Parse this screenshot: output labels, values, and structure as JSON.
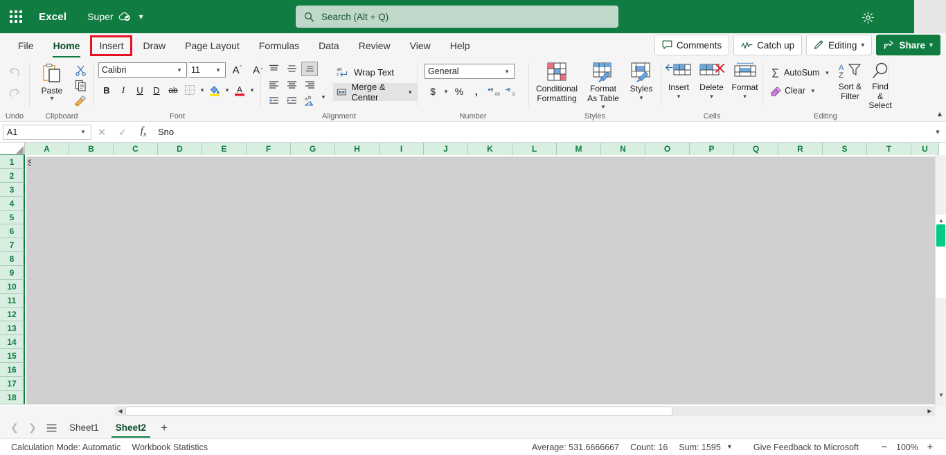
{
  "titlebar": {
    "app_name": "Excel",
    "doc_name": "Super",
    "waffle_icon": "app-launcher-icon",
    "cloud_icon": "cloud-saved-icon",
    "chevron_icon": "chevron-down-icon",
    "gear_icon": "gear-icon",
    "brand_color": "#107C41"
  },
  "search": {
    "placeholder": "Search (Alt + Q)",
    "value": "",
    "icon": "search-icon"
  },
  "ribbon_tabs": [
    {
      "label": "File",
      "active": false,
      "highlighted": false
    },
    {
      "label": "Home",
      "active": true,
      "highlighted": false
    },
    {
      "label": "Insert",
      "active": false,
      "highlighted": true
    },
    {
      "label": "Draw",
      "active": false,
      "highlighted": false
    },
    {
      "label": "Page Layout",
      "active": false,
      "highlighted": false
    },
    {
      "label": "Formulas",
      "active": false,
      "highlighted": false
    },
    {
      "label": "Data",
      "active": false,
      "highlighted": false
    },
    {
      "label": "Review",
      "active": false,
      "highlighted": false
    },
    {
      "label": "View",
      "active": false,
      "highlighted": false
    },
    {
      "label": "Help",
      "active": false,
      "highlighted": false
    }
  ],
  "highlight_color": "#E81123",
  "tab_actions": {
    "comments": "Comments",
    "catch_up": "Catch up",
    "editing": "Editing",
    "share": "Share"
  },
  "ribbon": {
    "undo": {
      "label": "Undo",
      "undo_icon": "undo-icon",
      "redo_icon": "redo-icon"
    },
    "clipboard": {
      "label": "Clipboard",
      "paste": "Paste",
      "cut_icon": "cut-scissors-icon",
      "copy_icon": "copy-icon",
      "format_painter_icon": "format-painter-icon"
    },
    "font": {
      "label": "Font",
      "font_name": "Calibri",
      "font_size": "11",
      "grow_icon": "increase-font-size-icon",
      "shrink_icon": "decrease-font-size-icon",
      "bold": "B",
      "italic": "I",
      "underline": "U",
      "double_underline": "D",
      "strikethrough": "ab",
      "borders_icon": "borders-icon",
      "fill_color_icon": "fill-color-icon",
      "font_color_icon": "font-color-icon"
    },
    "alignment": {
      "label": "Alignment",
      "wrap_text": "Wrap Text",
      "merge_center": "Merge & Center",
      "top_align_icon": "align-top-icon",
      "middle_align_icon": "align-middle-icon",
      "bottom_align_icon": "align-bottom-icon",
      "left_align_icon": "align-left-icon",
      "center_align_icon": "align-center-icon",
      "right_align_icon": "align-right-icon",
      "decrease_indent_icon": "decrease-indent-icon",
      "increase_indent_icon": "increase-indent-icon",
      "orientation_icon": "text-orientation-icon"
    },
    "number": {
      "label": "Number",
      "format": "General",
      "currency_icon": "currency-icon",
      "percent_icon": "percent-style-icon",
      "comma_icon": "comma-style-icon",
      "increase_decimal_icon": "increase-decimal-icon",
      "decrease_decimal_icon": "decrease-decimal-icon"
    },
    "styles": {
      "label": "Styles",
      "conditional_formatting": "Conditional Formatting",
      "format_as_table": "Format As Table",
      "cell_styles": "Styles"
    },
    "cells": {
      "label": "Cells",
      "insert": "Insert",
      "delete": "Delete",
      "format": "Format"
    },
    "editing": {
      "label": "Editing",
      "autosum": "AutoSum",
      "clear": "Clear",
      "sort_filter": "Sort & Filter",
      "find_select": "Find & Select",
      "autosum_icon": "sigma-icon",
      "clear_icon": "eraser-icon",
      "sort_filter_icon": "sort-filter-icon",
      "find_select_icon": "magnifier-icon"
    },
    "collapse_icon": "collapse-ribbon-icon"
  },
  "formula_bar": {
    "name_box": "A1",
    "name_box_chevron": "chevron-down-icon",
    "cancel_icon": "cancel-icon",
    "enter_icon": "confirm-check-icon",
    "function_icon": "insert-function-icon",
    "value": "Sno",
    "expand_icon": "expand-formula-bar-icon"
  },
  "grid": {
    "columns": [
      "A",
      "B",
      "C",
      "D",
      "E",
      "F",
      "G",
      "H",
      "I",
      "J",
      "K",
      "L",
      "M",
      "N",
      "O",
      "P",
      "Q",
      "R",
      "S",
      "T",
      "U"
    ],
    "rows": [
      1,
      2,
      3,
      4,
      5,
      6,
      7,
      8,
      9,
      10,
      11,
      12,
      13,
      14,
      15,
      16,
      17,
      18
    ],
    "active_cell": "A1",
    "active_cell_text": "S",
    "select_all_icon": "select-all-icon"
  },
  "sheet_tabs": {
    "prev_icon": "previous-sheet-icon",
    "next_icon": "next-sheet-icon",
    "all_sheets_icon": "all-sheets-menu-icon",
    "tabs": [
      {
        "label": "Sheet1",
        "active": false
      },
      {
        "label": "Sheet2",
        "active": true
      }
    ],
    "add_label": "+"
  },
  "status_bar": {
    "calculation_mode": "Calculation Mode: Automatic",
    "workbook_statistics": "Workbook Statistics",
    "average": "Average: 531.6666667",
    "count": "Count: 16",
    "sum": "Sum: 1595",
    "stats_chevron": "chevron-down-icon",
    "feedback": "Give Feedback to Microsoft",
    "zoom_out": "−",
    "zoom_level": "100%",
    "zoom_in": "+"
  }
}
